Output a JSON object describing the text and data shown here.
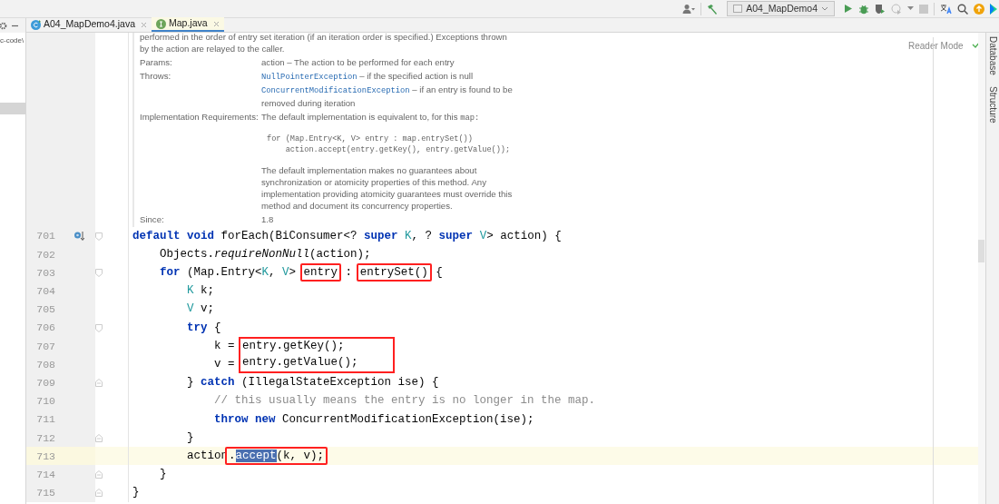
{
  "toolbar": {
    "run_config": "A04_MapDemo4"
  },
  "project_panel": {
    "path": "c-code\\"
  },
  "tabs": [
    {
      "label": "A04_MapDemo4.java",
      "kind": "class",
      "selected": false
    },
    {
      "label": "Map.java",
      "kind": "interface",
      "selected": true
    }
  ],
  "reader_mode": "Reader Mode",
  "right_tool_windows": [
    "Database",
    "Structure"
  ],
  "doc": {
    "intro": [
      "performed in the order of entry set iteration (if an iteration order is specified.) Exceptions thrown",
      "by the action are relayed to the caller."
    ],
    "sections": [
      {
        "label": "Params:",
        "items": [
          {
            "text": "action – The action to be performed for each entry"
          }
        ]
      },
      {
        "label": "Throws:",
        "items": [
          {
            "code": "NullPointerException",
            "text": " – if the specified action is null"
          },
          {
            "code": "ConcurrentModificationException",
            "text": " – if an entry is found to be removed during iteration"
          }
        ]
      },
      {
        "label": "Implementation Requirements:",
        "items": [
          {
            "text": "The default implementation is equivalent to, for this ",
            "code_end": "map:"
          },
          {
            "pre": [
              "for (Map.Entry<K, V> entry : map.entrySet())",
              "    action.accept(entry.getKey(), entry.getValue());"
            ]
          },
          {
            "text": "The default implementation makes no guarantees about synchronization or atomicity properties of this method. Any implementation providing atomicity guarantees must override this method and document its concurrency properties."
          }
        ]
      },
      {
        "label": "Since:",
        "items": [
          {
            "text": "1.8"
          }
        ]
      }
    ]
  },
  "code": [
    {
      "number": "701",
      "current": false,
      "fold_start": true,
      "fold_end": false,
      "implements_marker": true,
      "tokens": [
        {
          "text": "default void ",
          "kind": "keyword"
        },
        {
          "text": "forEach(BiConsumer<? "
        },
        {
          "text": "super ",
          "kind": "keyword"
        },
        {
          "text": "K",
          "kind": "type"
        },
        {
          "text": ", ? "
        },
        {
          "text": "super ",
          "kind": "keyword"
        },
        {
          "text": "V",
          "kind": "type"
        },
        {
          "text": "> action) {"
        }
      ]
    },
    {
      "number": "702",
      "current": false,
      "fold_start": false,
      "fold_end": false,
      "implements_marker": false,
      "tokens": [
        {
          "text": "    Objects."
        },
        {
          "text": "requireNonNull",
          "kind": "static"
        },
        {
          "text": "(action);"
        }
      ]
    },
    {
      "number": "703",
      "current": false,
      "fold_start": true,
      "fold_end": false,
      "implements_marker": false,
      "tokens": [
        {
          "text": "    for ",
          "kind": "keyword"
        },
        {
          "text": "(Map.Entry<"
        },
        {
          "text": "K",
          "kind": "type"
        },
        {
          "text": ", "
        },
        {
          "text": "V",
          "kind": "type"
        },
        {
          "text": "> "
        },
        {
          "kind": "box",
          "parts": [
            {
              "text": "entry"
            }
          ]
        },
        {
          "text": " : "
        },
        {
          "kind": "box",
          "parts": [
            {
              "text": "entrySet()"
            }
          ]
        },
        {
          "text": " {"
        }
      ]
    },
    {
      "number": "704",
      "current": false,
      "fold_start": false,
      "fold_end": false,
      "implements_marker": false,
      "tokens": [
        {
          "text": "        K",
          "kind": "type"
        },
        {
          "text": " k;"
        }
      ]
    },
    {
      "number": "705",
      "current": false,
      "fold_start": false,
      "fold_end": false,
      "implements_marker": false,
      "tokens": [
        {
          "text": "        V",
          "kind": "type"
        },
        {
          "text": " v;"
        }
      ]
    },
    {
      "number": "706",
      "current": false,
      "fold_start": true,
      "fold_end": false,
      "implements_marker": false,
      "tokens": [
        {
          "text": "        try ",
          "kind": "keyword"
        },
        {
          "text": "{"
        }
      ]
    },
    {
      "number": "707",
      "current": false,
      "fold_start": false,
      "fold_end": false,
      "implements_marker": false,
      "tokens": [
        {
          "text": "            k = "
        },
        {
          "kind": "box_top",
          "parts": [
            {
              "text": "entry.getKey();"
            }
          ]
        }
      ]
    },
    {
      "number": "708",
      "current": false,
      "fold_start": false,
      "fold_end": false,
      "implements_marker": false,
      "tokens": [
        {
          "text": "            v = "
        },
        {
          "kind": "box_bottom",
          "parts": [
            {
              "text": "entry.getValue();"
            }
          ]
        }
      ]
    },
    {
      "number": "709",
      "current": false,
      "fold_start": false,
      "fold_end": true,
      "implements_marker": false,
      "tokens": [
        {
          "text": "        } "
        },
        {
          "text": "catch ",
          "kind": "keyword"
        },
        {
          "text": "(IllegalStateException ise) {"
        }
      ]
    },
    {
      "number": "710",
      "current": false,
      "fold_start": false,
      "fold_end": false,
      "implements_marker": false,
      "tokens": [
        {
          "text": "            // this usually means the entry is no longer in the map.",
          "kind": "comment"
        }
      ]
    },
    {
      "number": "711",
      "current": false,
      "fold_start": false,
      "fold_end": false,
      "implements_marker": false,
      "tokens": [
        {
          "text": "            throw new ",
          "kind": "keyword"
        },
        {
          "text": "ConcurrentModificationException(ise);"
        }
      ]
    },
    {
      "number": "712",
      "current": false,
      "fold_start": false,
      "fold_end": true,
      "implements_marker": false,
      "tokens": [
        {
          "text": "        }"
        }
      ]
    },
    {
      "number": "713",
      "current": true,
      "fold_start": false,
      "fold_end": false,
      "implements_marker": false,
      "tokens": [
        {
          "text": "        action"
        },
        {
          "kind": "box",
          "parts": [
            {
              "text": "."
            },
            {
              "text": "accept",
              "selected": true
            },
            {
              "text": "(k, v);"
            }
          ]
        }
      ]
    },
    {
      "number": "714",
      "current": false,
      "fold_start": false,
      "fold_end": true,
      "implements_marker": false,
      "tokens": [
        {
          "text": "    }"
        }
      ]
    },
    {
      "number": "715",
      "current": false,
      "fold_start": false,
      "fold_end": true,
      "implements_marker": false,
      "tokens": [
        {
          "text": "}"
        }
      ]
    }
  ]
}
